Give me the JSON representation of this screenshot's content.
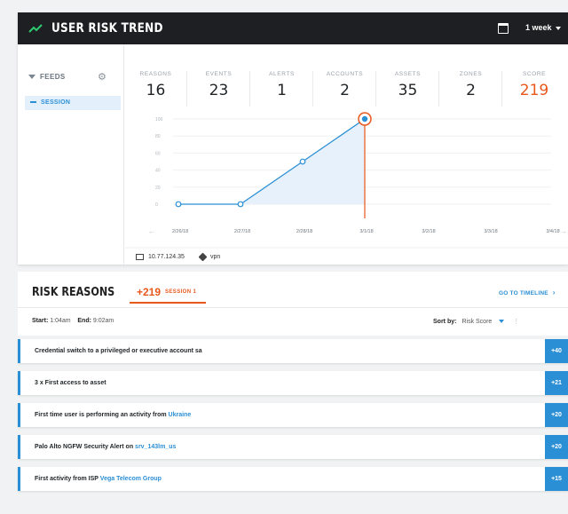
{
  "header": {
    "title": "USER RISK TREND",
    "range": "1 week"
  },
  "sidebar": {
    "feeds_label": "FEEDS",
    "session_label": "SESSION"
  },
  "stats": [
    {
      "label": "REASONS",
      "value": "16"
    },
    {
      "label": "EVENTS",
      "value": "23"
    },
    {
      "label": "ALERTS",
      "value": "1"
    },
    {
      "label": "ACCOUNTS",
      "value": "2"
    },
    {
      "label": "ASSETS",
      "value": "35"
    },
    {
      "label": "ZONES",
      "value": "2"
    },
    {
      "label": "SCORE",
      "value": "219"
    }
  ],
  "chart_data": {
    "type": "line",
    "categories": [
      "2/26/18",
      "2/27/18",
      "2/28/18",
      "3/1/18",
      "3/2/18",
      "3/3/18",
      "3/4/18"
    ],
    "series": [
      {
        "values": [
          0,
          0,
          50,
          100,
          null,
          null,
          null
        ]
      }
    ],
    "yticks": [
      "0",
      "20",
      "40",
      "60",
      "80",
      "100"
    ],
    "ylim": [
      0,
      100
    ],
    "highlight_index": 3,
    "colors": {
      "line": "#2b8fd6",
      "area": "#e3f0fb",
      "highlight": "#e8581b"
    }
  },
  "meta": {
    "ip": "10.77.124.35",
    "tag": "vpn"
  },
  "risk": {
    "title": "RISK REASONS",
    "score": "+219",
    "session": "SESSION 1",
    "goto": "GO TO TIMELINE",
    "start_label": "Start:",
    "start": "1:04am",
    "end_label": "End:",
    "end": "9:02am",
    "sort_label": "Sort by:",
    "sort_value": "Risk Score",
    "reasons": [
      {
        "text": "Credential switch to a privileged or executive account sa",
        "link": "",
        "points": "+40"
      },
      {
        "text": "3 x First access to asset",
        "link": "",
        "points": "+21"
      },
      {
        "text": "First time user is performing an activity from ",
        "link": "Ukraine",
        "points": "+20"
      },
      {
        "text": "Palo Alto NGFW Security Alert on ",
        "link": "srv_143lm_us",
        "points": "+20"
      },
      {
        "text": "First activity from ISP ",
        "link": "Vega Telecom Group",
        "points": "+15"
      }
    ]
  }
}
